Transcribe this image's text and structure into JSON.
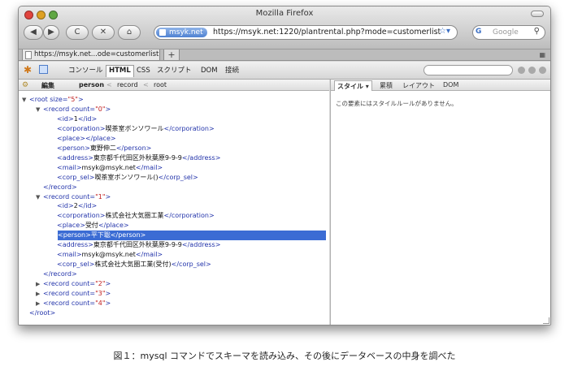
{
  "window": {
    "title": "Mozilla Firefox"
  },
  "nav": {
    "back_icon": "back-arrow-icon",
    "forward_icon": "forward-arrow-icon",
    "reload_icon": "reload-icon",
    "stop_icon": "stop-icon",
    "home_icon": "home-icon",
    "reload_glyph": "C",
    "stop_glyph": "✕",
    "home_glyph": "⌂",
    "back_glyph": "◀",
    "forward_glyph": "▶"
  },
  "urlbar": {
    "host": "msyk.net",
    "url": "https://msyk.net:1220/plantrental.php?mode=customerlist",
    "star": "☆▾"
  },
  "search": {
    "engine": "G",
    "placeholder": "Google",
    "mag": "⚲"
  },
  "tabs": [
    {
      "label": "https://msyk.net...ode=customerlist"
    }
  ],
  "new_tab": "+",
  "firebug": {
    "tabs": [
      "コンソール",
      "HTML",
      "CSS",
      "スクリプト",
      "DOM",
      "接続"
    ],
    "active_tab": "HTML",
    "breadcrumb": {
      "edit": "編集",
      "items": [
        "person",
        "record",
        "root"
      ],
      "sep": "<"
    },
    "side_tabs": [
      "スタイル ▾",
      "累積",
      "レイアウト",
      "DOM"
    ],
    "no_style_message": "この要素にはスタイルルールがありません。"
  },
  "tree": [
    {
      "indent": 0,
      "twisty": "▼",
      "parts": [
        [
          "tag",
          "<root "
        ],
        [
          "attr",
          "size="
        ],
        [
          "val",
          "\"5\""
        ],
        [
          "tag",
          ">"
        ]
      ]
    },
    {
      "indent": 1,
      "twisty": "▼",
      "parts": [
        [
          "tag",
          "<record "
        ],
        [
          "attr",
          "count="
        ],
        [
          "val",
          "\"0\""
        ],
        [
          "tag",
          ">"
        ]
      ]
    },
    {
      "indent": 2,
      "twisty": "",
      "parts": [
        [
          "tag",
          "<id>"
        ],
        [
          "txt",
          "1"
        ],
        [
          "tag",
          "</id>"
        ]
      ]
    },
    {
      "indent": 2,
      "twisty": "",
      "parts": [
        [
          "tag",
          "<corporation>"
        ],
        [
          "txt",
          "喫茶室ボンソワール"
        ],
        [
          "tag",
          "</corporation>"
        ]
      ]
    },
    {
      "indent": 2,
      "twisty": "",
      "parts": [
        [
          "tag",
          "<place>"
        ],
        [
          "tag",
          "</place>"
        ]
      ]
    },
    {
      "indent": 2,
      "twisty": "",
      "parts": [
        [
          "tag",
          "<person>"
        ],
        [
          "txt",
          "東野伸二"
        ],
        [
          "tag",
          "</person>"
        ]
      ]
    },
    {
      "indent": 2,
      "twisty": "",
      "parts": [
        [
          "tag",
          "<address>"
        ],
        [
          "txt",
          "東京都千代田区外秋葉原9-9-9"
        ],
        [
          "tag",
          "</address>"
        ]
      ]
    },
    {
      "indent": 2,
      "twisty": "",
      "parts": [
        [
          "tag",
          "<mail>"
        ],
        [
          "txt",
          "msyk@msyk.net"
        ],
        [
          "tag",
          "</mail>"
        ]
      ]
    },
    {
      "indent": 2,
      "twisty": "",
      "parts": [
        [
          "tag",
          "<corp_sel>"
        ],
        [
          "txt",
          "喫茶室ボンソワール()"
        ],
        [
          "tag",
          "</corp_sel>"
        ]
      ]
    },
    {
      "indent": 1,
      "twisty": "",
      "parts": [
        [
          "tag",
          "</record>"
        ]
      ]
    },
    {
      "indent": 1,
      "twisty": "▼",
      "parts": [
        [
          "tag",
          "<record "
        ],
        [
          "attr",
          "count="
        ],
        [
          "val",
          "\"1\""
        ],
        [
          "tag",
          ">"
        ]
      ]
    },
    {
      "indent": 2,
      "twisty": "",
      "parts": [
        [
          "tag",
          "<id>"
        ],
        [
          "txt",
          "2"
        ],
        [
          "tag",
          "</id>"
        ]
      ]
    },
    {
      "indent": 2,
      "twisty": "",
      "parts": [
        [
          "tag",
          "<corporation>"
        ],
        [
          "txt",
          "株式会社大気圏工業"
        ],
        [
          "tag",
          "</corporation>"
        ]
      ]
    },
    {
      "indent": 2,
      "twisty": "",
      "parts": [
        [
          "tag",
          "<place>"
        ],
        [
          "txt",
          "受付"
        ],
        [
          "tag",
          "</place>"
        ]
      ]
    },
    {
      "indent": 2,
      "twisty": "",
      "selected": true,
      "parts": [
        [
          "tag",
          "<person>"
        ],
        [
          "txt",
          "平下聡"
        ],
        [
          "tag",
          "</person>"
        ]
      ]
    },
    {
      "indent": 2,
      "twisty": "",
      "parts": [
        [
          "tag",
          "<address>"
        ],
        [
          "txt",
          "東京都千代田区外秋葉原9-9-9"
        ],
        [
          "tag",
          "</address>"
        ]
      ]
    },
    {
      "indent": 2,
      "twisty": "",
      "parts": [
        [
          "tag",
          "<mail>"
        ],
        [
          "txt",
          "msyk@msyk.net"
        ],
        [
          "tag",
          "</mail>"
        ]
      ]
    },
    {
      "indent": 2,
      "twisty": "",
      "parts": [
        [
          "tag",
          "<corp_sel>"
        ],
        [
          "txt",
          "株式会社大気圏工業(受付)"
        ],
        [
          "tag",
          "</corp_sel>"
        ]
      ]
    },
    {
      "indent": 1,
      "twisty": "",
      "parts": [
        [
          "tag",
          "</record>"
        ]
      ]
    },
    {
      "indent": 1,
      "twisty": "▶",
      "parts": [
        [
          "tag",
          "<record "
        ],
        [
          "attr",
          "count="
        ],
        [
          "val",
          "\"2\""
        ],
        [
          "tag",
          ">"
        ]
      ]
    },
    {
      "indent": 1,
      "twisty": "▶",
      "parts": [
        [
          "tag",
          "<record "
        ],
        [
          "attr",
          "count="
        ],
        [
          "val",
          "\"3\""
        ],
        [
          "tag",
          ">"
        ]
      ]
    },
    {
      "indent": 1,
      "twisty": "▶",
      "parts": [
        [
          "tag",
          "<record "
        ],
        [
          "attr",
          "count="
        ],
        [
          "val",
          "\"4\""
        ],
        [
          "tag",
          ">"
        ]
      ]
    },
    {
      "indent": 0,
      "twisty": "",
      "parts": [
        [
          "tag",
          "</root>"
        ]
      ]
    }
  ],
  "caption": "図１：mysql コマンドでスキーマを読み込み、その後にデータベースの中身を調べた",
  "colors": {
    "selection": "#3b6cd4",
    "tag": "#2233aa",
    "value": "#c02020"
  }
}
